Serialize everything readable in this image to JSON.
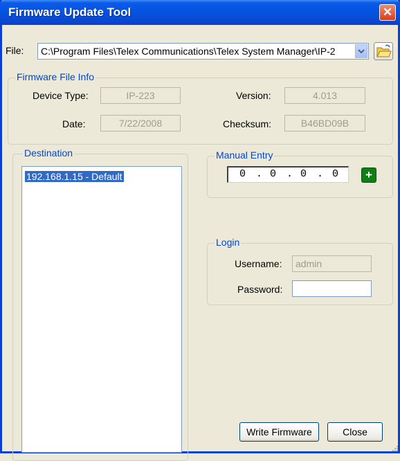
{
  "window": {
    "title": "Firmware Update Tool",
    "close_symbol": "✕"
  },
  "file": {
    "label": "File:",
    "path": "C:\\Program Files\\Telex Communications\\Telex System Manager\\IP-2"
  },
  "firmware_info": {
    "group_title": "Firmware File Info",
    "device_type_label": "Device Type:",
    "device_type": "IP-223",
    "version_label": "Version:",
    "version": "4.013",
    "date_label": "Date:",
    "date": "7/22/2008",
    "checksum_label": "Checksum:",
    "checksum": "B46BD09B"
  },
  "destination": {
    "group_title": "Destination",
    "items": [
      "192.168.1.15 - Default"
    ]
  },
  "manual_entry": {
    "group_title": "Manual Entry",
    "octets": [
      "0",
      "0",
      "0",
      "0"
    ],
    "dot": ".",
    "add_symbol": "+"
  },
  "login": {
    "group_title": "Login",
    "username_label": "Username:",
    "username": "admin",
    "password_label": "Password:",
    "password": ""
  },
  "buttons": {
    "write_firmware": "Write Firmware",
    "close": "Close"
  },
  "colors": {
    "titlebar": "#0552e0",
    "group_title": "#0046d5",
    "selection": "#316ac5",
    "add_button": "#0e7f15"
  }
}
